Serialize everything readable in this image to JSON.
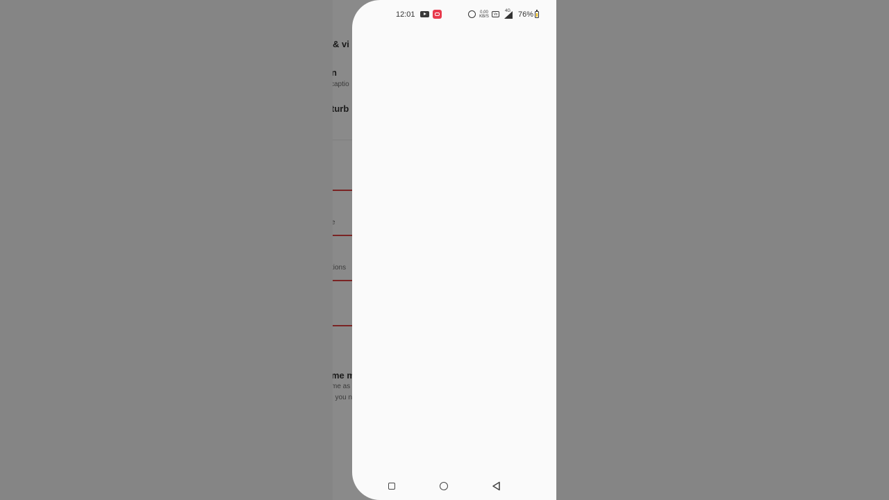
{
  "background_screen": {
    "rows": [
      {
        "title": "& vi",
        "subtitle": ""
      },
      {
        "title": "n",
        "subtitle": "captio"
      },
      {
        "title": "turb",
        "subtitle": ""
      },
      {
        "title": "",
        "subtitle": "e"
      },
      {
        "title": "",
        "subtitle": "tions"
      },
      {
        "title": "me m",
        "subtitle": "me as"
      },
      {
        "title": "",
        "subtitle": ", you n"
      }
    ]
  },
  "status_bar": {
    "time": "12:01",
    "net_speed_value": "0.00",
    "net_speed_unit": "KB/S",
    "volte": "Vo",
    "network_type": "4G",
    "battery_percent": "76%"
  },
  "icons": {
    "youtube": "youtube-icon",
    "screen_record": "screen-record-icon",
    "alarm": "alarm-icon",
    "volte": "volte-icon",
    "signal": "signal-icon",
    "battery": "battery-charging-icon",
    "recents": "recents-square-icon",
    "home": "home-circle-icon",
    "back": "back-triangle-icon"
  },
  "colors": {
    "scrim": "#858585",
    "sheet": "#fafafa",
    "accent_red": "#e8394c"
  }
}
